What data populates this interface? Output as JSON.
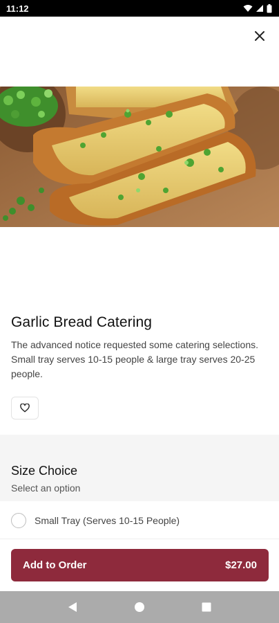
{
  "status_bar": {
    "time": "11:12",
    "icons": [
      "wifi-icon",
      "signal-icon",
      "battery-icon"
    ]
  },
  "header": {
    "close_icon": "close-icon"
  },
  "item": {
    "title": "Garlic Bread Catering",
    "description": "The advanced notice requested some catering selections. Small tray serves 10-15 people & large tray serves 20-25 people.",
    "image": "garlic-bread-photo"
  },
  "favorite": {
    "icon": "heart-icon"
  },
  "options_section": {
    "title": "Size Choice",
    "subtitle": "Select an option",
    "options": [
      {
        "label": "Small Tray (Serves 10-15 People)",
        "selected": false
      }
    ]
  },
  "order_button": {
    "label": "Add to Order",
    "price": "$27.00",
    "color": "#8e2a3c"
  },
  "nav_bar": {
    "icons": [
      "back-icon",
      "home-icon",
      "recents-icon"
    ]
  }
}
